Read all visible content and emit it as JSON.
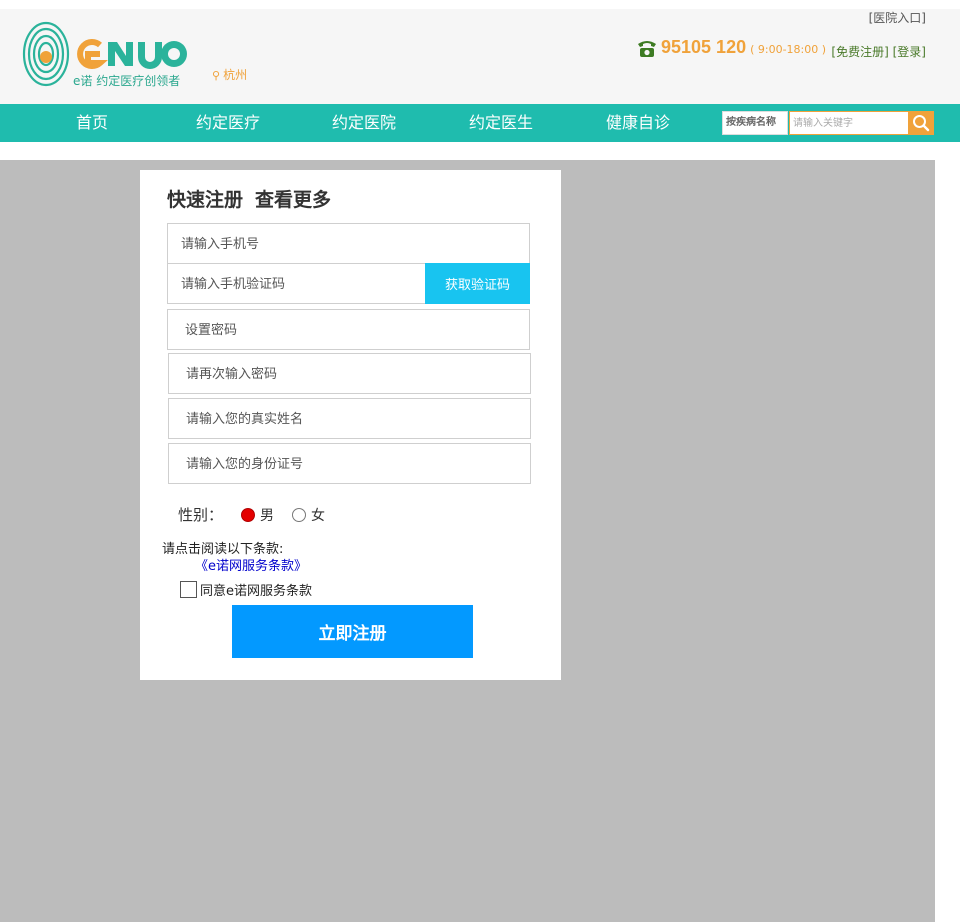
{
  "header": {
    "logo_slogan": "e诺  约定医疗创领者",
    "location": "杭州",
    "hospital_entry": "[医院入口]",
    "phone_number": "95105 120",
    "phone_hours": "( 9:00-18:00 )",
    "register_link": "[免费注册]",
    "login_link": "[登录]"
  },
  "nav": {
    "items": [
      "首页",
      "约定医疗",
      "约定医院",
      "约定医生",
      "健康自诊"
    ],
    "search_type": "按疾病名称",
    "search_placeholder": "请输入关键字"
  },
  "form": {
    "title_main": "快速注册",
    "title_more": "查看更多",
    "phone_placeholder": "请输入手机号",
    "code_placeholder": "请输入手机验证码",
    "get_code_label": "获取验证码",
    "password_placeholder": "设置密码",
    "password_confirm_placeholder": "请再次输入密码",
    "real_name_placeholder": "请输入您的真实姓名",
    "id_number_placeholder": "请输入您的身份证号",
    "gender_label": "性别：",
    "gender_male": "男",
    "gender_female": "女",
    "gender_selected": "男",
    "terms_intro": "请点击阅读以下条款:",
    "terms_link": "《e诺网服务条款》",
    "agree_label": "同意e诺网服务条款",
    "agree_checked": false,
    "submit_label": "立即注册"
  },
  "colors": {
    "brand_teal": "#1fbcae",
    "brand_orange": "#f0a23a",
    "code_button": "#18c4f0",
    "submit_button": "#0399ff",
    "overlay": "#bcbcbc"
  }
}
